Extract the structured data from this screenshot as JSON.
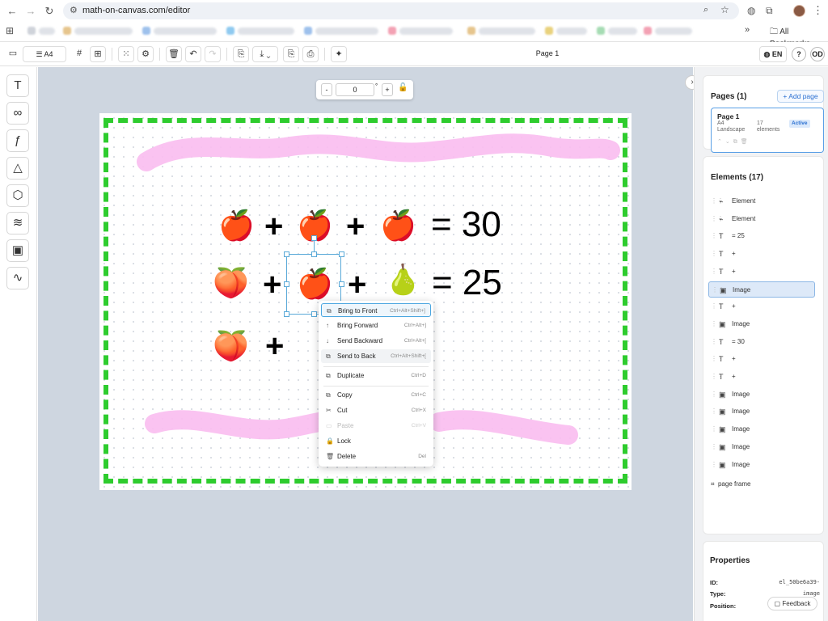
{
  "browser": {
    "url": "math-on-canvas.com/editor",
    "all_bookmarks": "All Bookmarks"
  },
  "toolbar": {
    "paper_size": "A4",
    "page_label": "Page 1",
    "language": "EN",
    "help": "?",
    "user_initials": "OD"
  },
  "rotation": {
    "value": "0",
    "unit": "°",
    "minus": "-",
    "plus": "+"
  },
  "canvas": {
    "row1": {
      "equals": "= 30"
    },
    "row2": {
      "equals": "= 25"
    },
    "plus": "+",
    "frame_color": "#2ecc2e",
    "stroke_color": "#f9bdf0",
    "emoji_apple": "🍎",
    "emoji_peach": "🍑",
    "emoji_pear": "🍐"
  },
  "context_menu": {
    "items": [
      {
        "label": "Bring to Front",
        "shortcut": "Ctrl+Alt+Shift+]",
        "icon": "⧉"
      },
      {
        "label": "Bring Forward",
        "shortcut": "Ctrl+Alt+]",
        "icon": "↑"
      },
      {
        "label": "Send Backward",
        "shortcut": "Ctrl+Alt+[",
        "icon": "↓"
      },
      {
        "label": "Send to Back",
        "shortcut": "Ctrl+Alt+Shift+[",
        "icon": "⧉"
      },
      {
        "label": "Duplicate",
        "shortcut": "Ctrl+D",
        "icon": "⧉"
      },
      {
        "label": "Copy",
        "shortcut": "Ctrl+C",
        "icon": "⧉"
      },
      {
        "label": "Cut",
        "shortcut": "Ctrl+X",
        "icon": "✂"
      },
      {
        "label": "Paste",
        "shortcut": "Ctrl+V",
        "icon": "▭"
      },
      {
        "label": "Lock",
        "shortcut": "",
        "icon": "🔒"
      },
      {
        "label": "Delete",
        "shortcut": "Del",
        "icon": "🗑"
      }
    ]
  },
  "pages": {
    "title": "Pages (1)",
    "add_label": "+ Add page",
    "card": {
      "title": "Page 1",
      "size": "A4",
      "orientation": "Landscape",
      "count": "17",
      "count_label": "elements",
      "status": "Active"
    }
  },
  "elements": {
    "title": "Elements (17)",
    "items": [
      {
        "label": "Element",
        "icon": "⌁"
      },
      {
        "label": "Element",
        "icon": "⌁"
      },
      {
        "label": "= 25",
        "icon": "T"
      },
      {
        "label": "+",
        "icon": "T"
      },
      {
        "label": "+",
        "icon": "T"
      },
      {
        "label": "Image",
        "icon": "▣"
      },
      {
        "label": "+",
        "icon": "T"
      },
      {
        "label": "Image",
        "icon": "▣"
      },
      {
        "label": "= 30",
        "icon": "T"
      },
      {
        "label": "+",
        "icon": "T"
      },
      {
        "label": "+",
        "icon": "T"
      },
      {
        "label": "Image",
        "icon": "▣"
      },
      {
        "label": "Image",
        "icon": "▣"
      },
      {
        "label": "Image",
        "icon": "▣"
      },
      {
        "label": "Image",
        "icon": "▣"
      },
      {
        "label": "Image",
        "icon": "▣"
      }
    ],
    "frame_label": "page frame"
  },
  "properties": {
    "title": "Properties",
    "id_label": "ID:",
    "id_value": "el_50be6a39-",
    "type_label": "Type:",
    "type_value": "image",
    "position_label": "Position:"
  },
  "feedback": "Feedback"
}
